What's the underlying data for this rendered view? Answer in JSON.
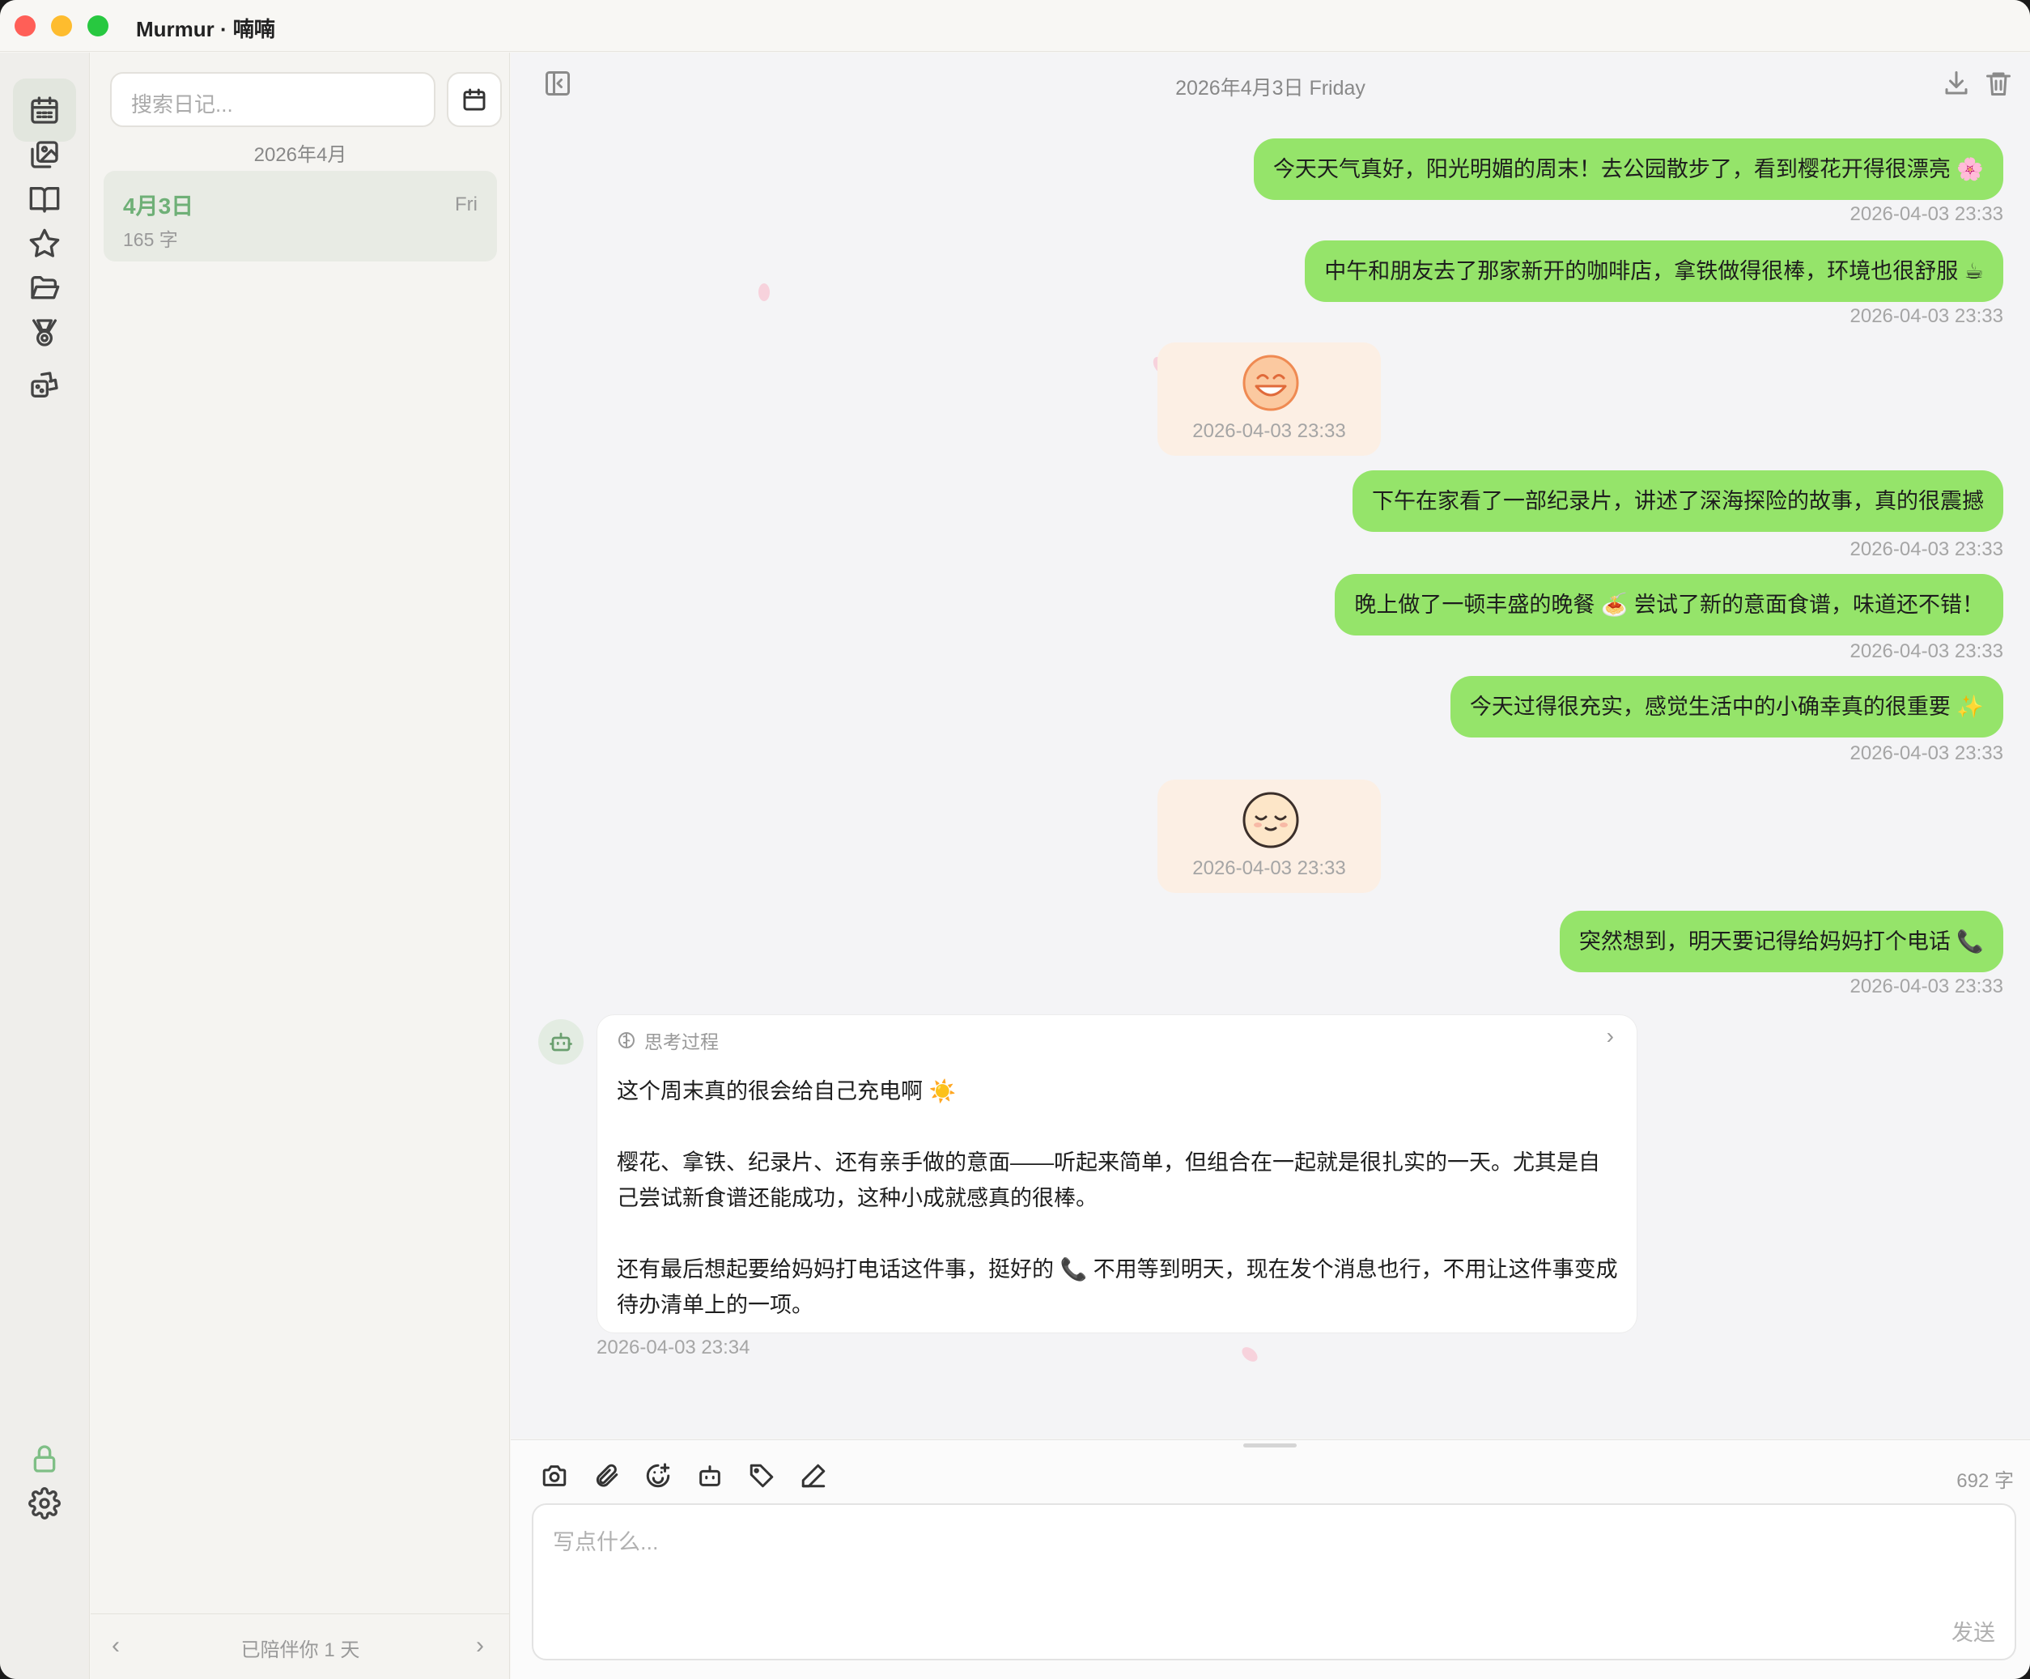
{
  "window": {
    "title": "Murmur · 喃喃"
  },
  "sidebar": {
    "icons": [
      "calendar-icon",
      "gallery-icon",
      "book-icon",
      "star-icon",
      "folder-icon",
      "medal-icon",
      "dice-icon",
      "lock-icon",
      "gear-icon"
    ],
    "active": "calendar-icon"
  },
  "diary_list": {
    "search_placeholder": "搜索日记...",
    "month": "2026年4月",
    "entries": [
      {
        "date": "4月3日",
        "weekday": "Fri",
        "count": "165 字"
      }
    ],
    "footer_text": "已陪伴你 1 天",
    "prev_glyph": "‹",
    "next_glyph": "›"
  },
  "chat": {
    "header_date": "2026年4月3日 Friday",
    "messages": [
      {
        "text": "今天天气真好，阳光明媚的周末！去公园散步了，看到樱花开得很漂亮 🌸",
        "time": "2026-04-03 23:33"
      },
      {
        "text": "中午和朋友去了那家新开的咖啡店，拿铁做得很棒，环境也很舒服 ☕",
        "time": "2026-04-03 23:33"
      },
      {
        "sticker": "grinning-face",
        "time": "2026-04-03 23:33"
      },
      {
        "text": "下午在家看了一部纪录片，讲述了深海探险的故事，真的很震撼",
        "time": "2026-04-03 23:33"
      },
      {
        "text": "晚上做了一顿丰盛的晚餐 🍝 尝试了新的意面食谱，味道还不错！",
        "time": "2026-04-03 23:33"
      },
      {
        "text": "今天过得很充实，感觉生活中的小确幸真的很重要 ✨",
        "time": "2026-04-03 23:33"
      },
      {
        "sticker": "content-face",
        "time": "2026-04-03 23:33"
      },
      {
        "text": "突然想到，明天要记得给妈妈打个电话 📞",
        "time": "2026-04-03 23:33"
      }
    ],
    "ai_reply": {
      "thinking_label": "思考过程",
      "paragraphs": [
        "这个周末真的很会给自己充电啊 ☀️",
        "樱花、拿铁、纪录片、还有亲手做的意面——听起来简单，但组合在一起就是很扎实的一天。尤其是自己尝试新食谱还能成功，这种小成就感真的很棒。",
        "还有最后想起要给妈妈打电话这件事，挺好的 📞 不用等到明天，现在发个消息也行，不用让这件事变成待办清单上的一项。"
      ],
      "time": "2026-04-03 23:34"
    }
  },
  "composer": {
    "tools": [
      "camera-icon",
      "paperclip-icon",
      "emoji-icon",
      "robot-icon",
      "tag-icon",
      "pen-icon"
    ],
    "word_count": "692 字",
    "placeholder": "写点什么...",
    "send_label": "发送"
  },
  "colors": {
    "accent_green": "#95e46a",
    "entry_green": "#6fb077"
  }
}
